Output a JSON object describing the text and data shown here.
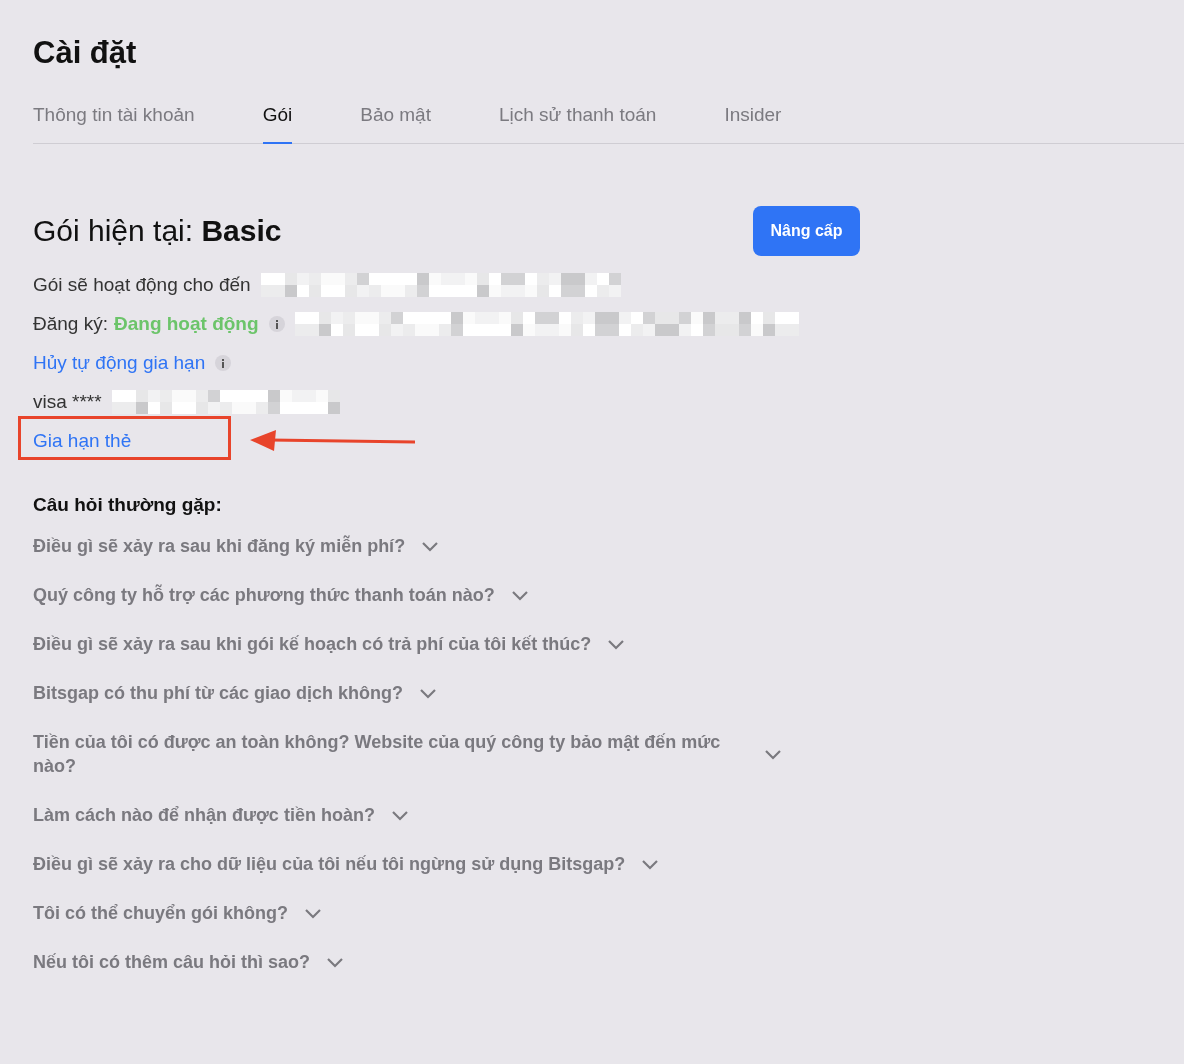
{
  "page": {
    "title": "Cài đặt"
  },
  "tabs": [
    {
      "label": "Thông tin tài khoản",
      "selected": false
    },
    {
      "label": "Gói",
      "selected": true
    },
    {
      "label": "Bảo mật",
      "selected": false
    },
    {
      "label": "Lịch sử thanh toán",
      "selected": false
    },
    {
      "label": "Insider",
      "selected": false
    }
  ],
  "plan": {
    "label": "Gói hiện tại:",
    "name": "Basic",
    "upgrade_button": "Nâng cấp",
    "active_until": {
      "label": "Gói sẽ hoạt động cho đến",
      "redacted": true
    },
    "subscription": {
      "label": "Đăng ký:",
      "status": "Đang hoạt động",
      "redacted": true
    },
    "cancel_link": "Hủy tự động gia hạn",
    "card": {
      "label": "visa ****",
      "redacted": true
    },
    "renew_link": {
      "text": "Gia hạn thẻ",
      "highlighted": true
    }
  },
  "faq": {
    "title": "Câu hỏi thường gặp:",
    "items": [
      {
        "question": "Điều gì sẽ xảy ra sau khi đăng ký miễn phí?",
        "expanded": false
      },
      {
        "question": "Quý công ty hỗ trợ các phương thức thanh toán nào?",
        "expanded": false
      },
      {
        "question": "Điều gì sẽ xảy ra sau khi gói kế hoạch có trả phí của tôi kết thúc?",
        "expanded": false
      },
      {
        "question": "Bitsgap có thu phí từ các giao dịch không?",
        "expanded": false
      },
      {
        "question": "Tiền của tôi có được an toàn không? Website của quý công ty bảo mật đến mức nào?",
        "expanded": false
      },
      {
        "question": "Làm cách nào để nhận được tiền hoàn?",
        "expanded": false
      },
      {
        "question": "Điều gì sẽ xảy ra cho dữ liệu của tôi nếu tôi ngừng sử dụng Bitsgap?",
        "expanded": false
      },
      {
        "question": "Tôi có thể chuyển gói không?",
        "expanded": false
      },
      {
        "question": "Nếu tôi có thêm câu hỏi thì sao?",
        "expanded": false
      }
    ]
  }
}
